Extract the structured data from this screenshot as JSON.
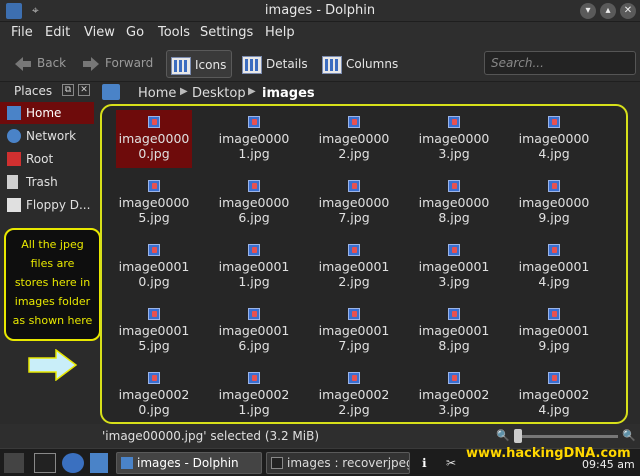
{
  "window": {
    "title": "images - Dolphin"
  },
  "menu": [
    "File",
    "Edit",
    "View",
    "Go",
    "Tools",
    "Settings",
    "Help"
  ],
  "toolbar": {
    "back": "Back",
    "forward": "Forward",
    "view_icons": "Icons",
    "view_details": "Details",
    "view_columns": "Columns",
    "search_placeholder": "Search..."
  },
  "places": {
    "header": "Places",
    "items": [
      "Home",
      "Network",
      "Root",
      "Trash",
      "Floppy D..."
    ]
  },
  "breadcrumb": [
    "Home",
    "Desktop",
    "images"
  ],
  "files": [
    "image00000.jpg",
    "image00001.jpg",
    "image00002.jpg",
    "image00003.jpg",
    "image00004.jpg",
    "image00005.jpg",
    "image00006.jpg",
    "image00007.jpg",
    "image00008.jpg",
    "image00009.jpg",
    "image00010.jpg",
    "image00011.jpg",
    "image00012.jpg",
    "image00013.jpg",
    "image00014.jpg",
    "image00015.jpg",
    "image00016.jpg",
    "image00017.jpg",
    "image00018.jpg",
    "image00019.jpg",
    "image00020.jpg",
    "image00021.jpg",
    "image00022.jpg",
    "image00023.jpg",
    "image00024.jpg"
  ],
  "file_labels": [
    [
      "image0000",
      "0.jpg"
    ],
    [
      "image0000",
      "1.jpg"
    ],
    [
      "image0000",
      "2.jpg"
    ],
    [
      "image0000",
      "3.jpg"
    ],
    [
      "image0000",
      "4.jpg"
    ],
    [
      "image0000",
      "5.jpg"
    ],
    [
      "image0000",
      "6.jpg"
    ],
    [
      "image0000",
      "7.jpg"
    ],
    [
      "image0000",
      "8.jpg"
    ],
    [
      "image0000",
      "9.jpg"
    ],
    [
      "image0001",
      "0.jpg"
    ],
    [
      "image0001",
      "1.jpg"
    ],
    [
      "image0001",
      "2.jpg"
    ],
    [
      "image0001",
      "3.jpg"
    ],
    [
      "image0001",
      "4.jpg"
    ],
    [
      "image0001",
      "5.jpg"
    ],
    [
      "image0001",
      "6.jpg"
    ],
    [
      "image0001",
      "7.jpg"
    ],
    [
      "image0001",
      "8.jpg"
    ],
    [
      "image0001",
      "9.jpg"
    ],
    [
      "image0002",
      "0.jpg"
    ],
    [
      "image0002",
      "1.jpg"
    ],
    [
      "image0002",
      "2.jpg"
    ],
    [
      "image0002",
      "3.jpg"
    ],
    [
      "image0002",
      "4.jpg"
    ]
  ],
  "selected_file": "image00000.jpg",
  "annotation": {
    "lines": [
      "All the jpeg",
      "files are",
      "stores here in",
      "images folder",
      "as shown here"
    ],
    "color": "#e8e800"
  },
  "status": "'image00000.jpg' selected (3.2 MiB)",
  "taskbar": {
    "tasks": [
      "images - Dolphin",
      "images : recoverjpeg"
    ],
    "watermark": "www.hackingDNA.com",
    "clock": "09:45 am"
  },
  "colors": {
    "selection": "#6e0b0b",
    "highlight_border": "#d7e01a",
    "watermark": "#ffd700"
  }
}
